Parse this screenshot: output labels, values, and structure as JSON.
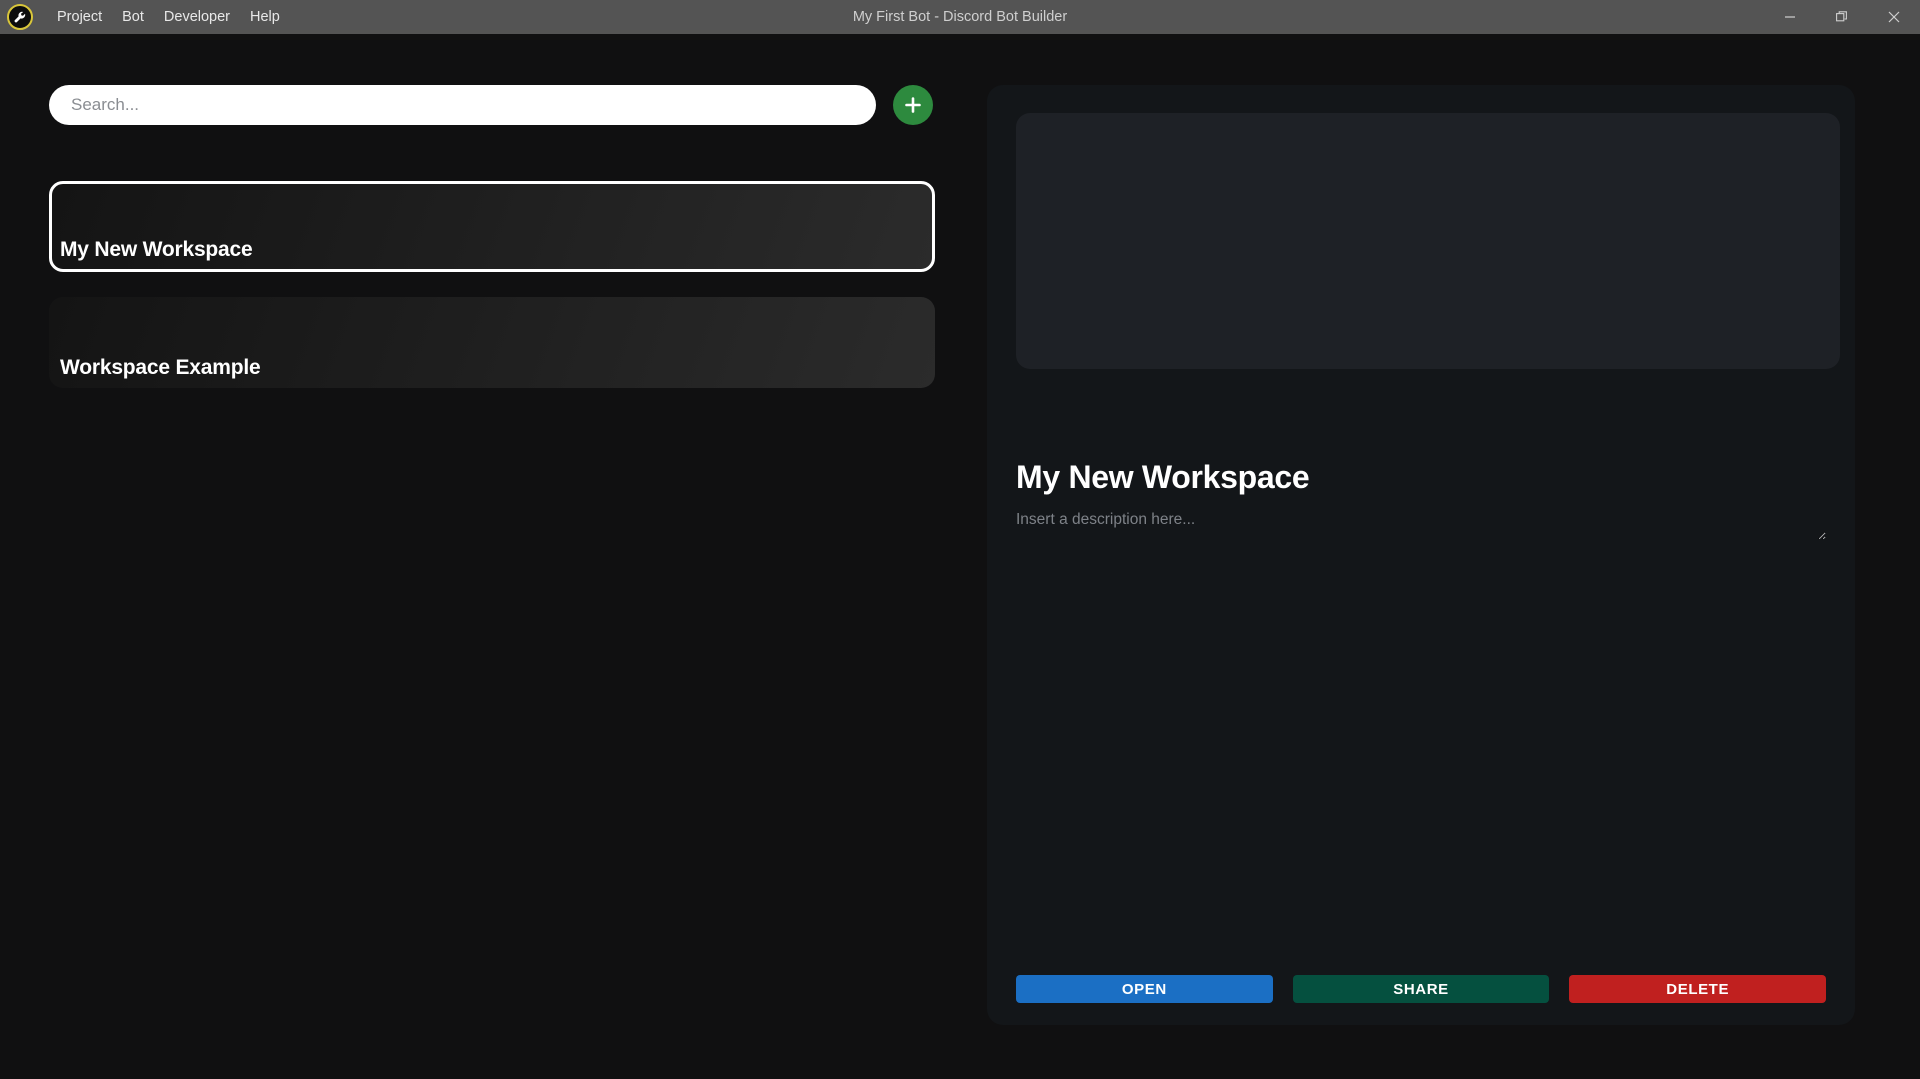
{
  "titlebar": {
    "logo_icon": "bot-wrench-logo-icon",
    "window_title": "My First Bot - Discord Bot Builder",
    "menu": [
      {
        "label": "Project"
      },
      {
        "label": "Bot"
      },
      {
        "label": "Developer"
      },
      {
        "label": "Help"
      }
    ],
    "controls": {
      "minimize_icon": "minimize-icon",
      "maximize_icon": "restore-window-icon",
      "close_icon": "close-icon"
    },
    "colors": {
      "bar_background": "#545454",
      "title_text": "#cfcfcf",
      "logo_ring": "#d9c63a"
    }
  },
  "left_pane": {
    "search": {
      "placeholder": "Search...",
      "value": ""
    },
    "add_button": {
      "icon": "plus-icon",
      "color": "#2d8a3e"
    },
    "workspaces": [
      {
        "name": "My New Workspace",
        "selected": true
      },
      {
        "name": "Workspace Example",
        "selected": false
      }
    ]
  },
  "detail_panel": {
    "banner": {
      "image": "",
      "background_color": "#1e2126"
    },
    "title": "My New Workspace",
    "description_value": "",
    "description_placeholder": "Insert a description here...",
    "resize_handle_icon": "resize-grip-icon",
    "actions": [
      {
        "label": "OPEN",
        "color": "#1b6fc4"
      },
      {
        "label": "SHARE",
        "color": "#05503f"
      },
      {
        "label": "DELETE",
        "color": "#c0201f"
      }
    ]
  }
}
